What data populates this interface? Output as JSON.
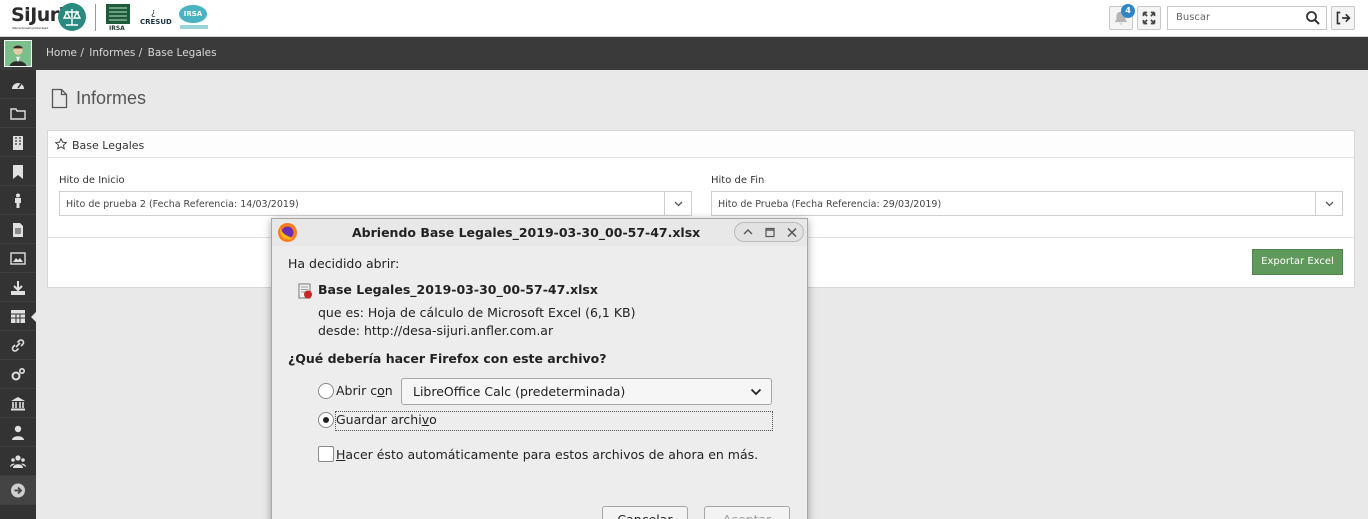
{
  "header": {
    "logo": {
      "main": "SiJuri",
      "tagline": "Sistema de Gestión Jurídica Integral",
      "partner_1": "IRSA",
      "partner_2": "CRESUD",
      "partner_3": "IRSA"
    },
    "notification_count": "4",
    "search_placeholder": "Buscar",
    "icons": [
      "bell-icon",
      "expand-icon",
      "search-icon",
      "logout-icon"
    ]
  },
  "breadcrumb": [
    "Home /",
    "Informes /",
    "Base Legales"
  ],
  "sidebar": {
    "icons": [
      "dashboard-icon",
      "folder-icon",
      "building-icon",
      "bookmark-icon",
      "person-icon",
      "document-icon",
      "image-icon",
      "download-icon",
      "table-icon",
      "link-icon",
      "cogs-icon",
      "institution-icon",
      "user-icon",
      "users-icon",
      "arrow-right-circle-icon"
    ],
    "active_index": 8
  },
  "page": {
    "title": "Informes",
    "panel_title": "Base Legales",
    "hito_inicio_label": "Hito de Inicio",
    "hito_inicio_value": "Hito de prueba 2 (Fecha Referencia: 14/03/2019)",
    "hito_fin_label": "Hito de Fin",
    "hito_fin_value": "Hito de Prueba (Fecha Referencia: 29/03/2019)",
    "export_button": "Exportar Excel"
  },
  "dialog": {
    "title": "Abriendo Base Legales_2019-03-30_00-57-47.xlsx",
    "intro": "Ha decidido abrir:",
    "filename": "Base Legales_2019-03-30_00-57-47.xlsx",
    "type_line": "que es: Hoja de cálculo de Microsoft Excel (6,1 KB)",
    "from_line": "desde: http://desa-sijuri.anfler.com.ar",
    "question": "¿Qué debería hacer Firefox con este archivo?",
    "open_with_pre": "Abrir c",
    "open_with_key": "o",
    "open_with_post": "n",
    "open_with_app": "LibreOffice Calc (predeterminada)",
    "save_pre": "Guardar archi",
    "save_key": "v",
    "save_post": "o",
    "auto_pre": "",
    "auto_key": "H",
    "auto_post": "acer ésto automáticamente para estos archivos de ahora en más.",
    "cancel_button": "Cancelar",
    "accept_button": "Aceptar",
    "selected_option": "Guardar archivo"
  }
}
